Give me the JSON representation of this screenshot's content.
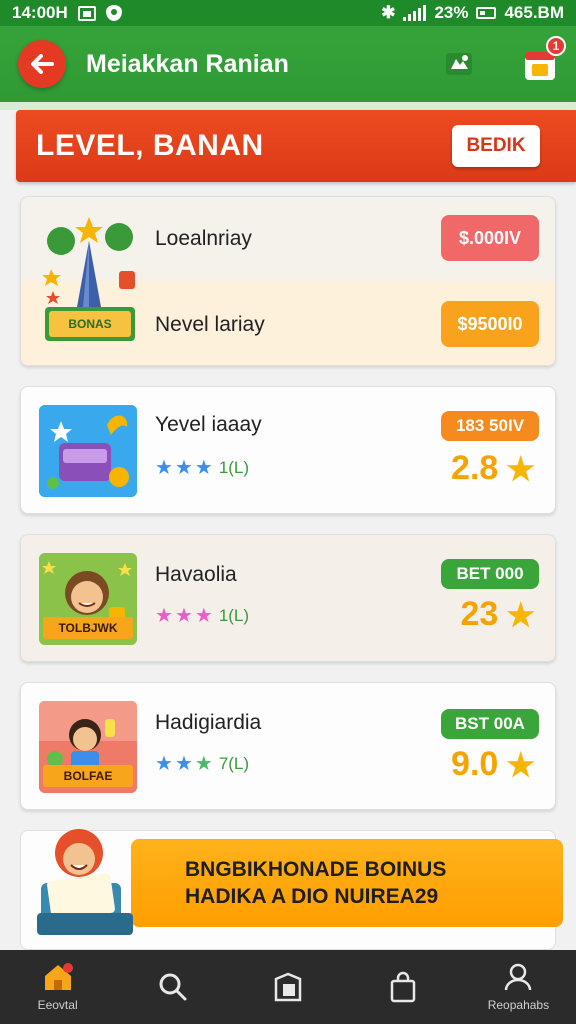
{
  "status_bar": {
    "time": "14:00H",
    "battery_percent": "23%",
    "clock_right": "465.BM"
  },
  "app_bar": {
    "title": "Meiakkan Ranian",
    "notification_count": "1"
  },
  "level_banner": {
    "title": "LEVEL, BANAN",
    "button_label": "BEDIK"
  },
  "cards": [
    {
      "rows": [
        {
          "title": "Loealnriay",
          "pill": "$.000IV",
          "pill_color": "#f06868"
        },
        {
          "title": "Nevel lariay",
          "pill": "$9500I0",
          "pill_color": "#f9a21c"
        }
      ],
      "thumb_caption": "BONAS"
    },
    {
      "title": "Yevel iaaay",
      "pill": "183 50IV",
      "pill_color": "#f58a1f",
      "stars": 3,
      "star_color": "#3b8fe8",
      "count": "1(L)",
      "rating": "2.8"
    },
    {
      "title": "Havaolia",
      "pill": "BET 000",
      "pill_color": "#3aa53a",
      "stars": 3,
      "star_color": "#ee5dc6",
      "count": "1(L)",
      "rating": "23",
      "thumb_caption": "TOLBJWK"
    },
    {
      "title": "Hadigiardia",
      "pill": "BST 00A",
      "pill_color": "#3aa53a",
      "stars": 3,
      "star_color": "#3b8fe8",
      "count": "7(L)",
      "rating": "9.0",
      "thumb_caption": "BOLFAE"
    }
  ],
  "bonus": {
    "line1": "BNGBIKHONADE BOINUS",
    "line2": "HADIKA A DIO NUIREA29"
  },
  "bottom_nav": [
    {
      "label": "Eeovtal",
      "icon": "home-icon"
    },
    {
      "label": "",
      "icon": "search-icon"
    },
    {
      "label": "",
      "icon": "book-icon"
    },
    {
      "label": "",
      "icon": "bag-icon"
    },
    {
      "label": "Reopahabs",
      "icon": "profile-icon"
    }
  ]
}
